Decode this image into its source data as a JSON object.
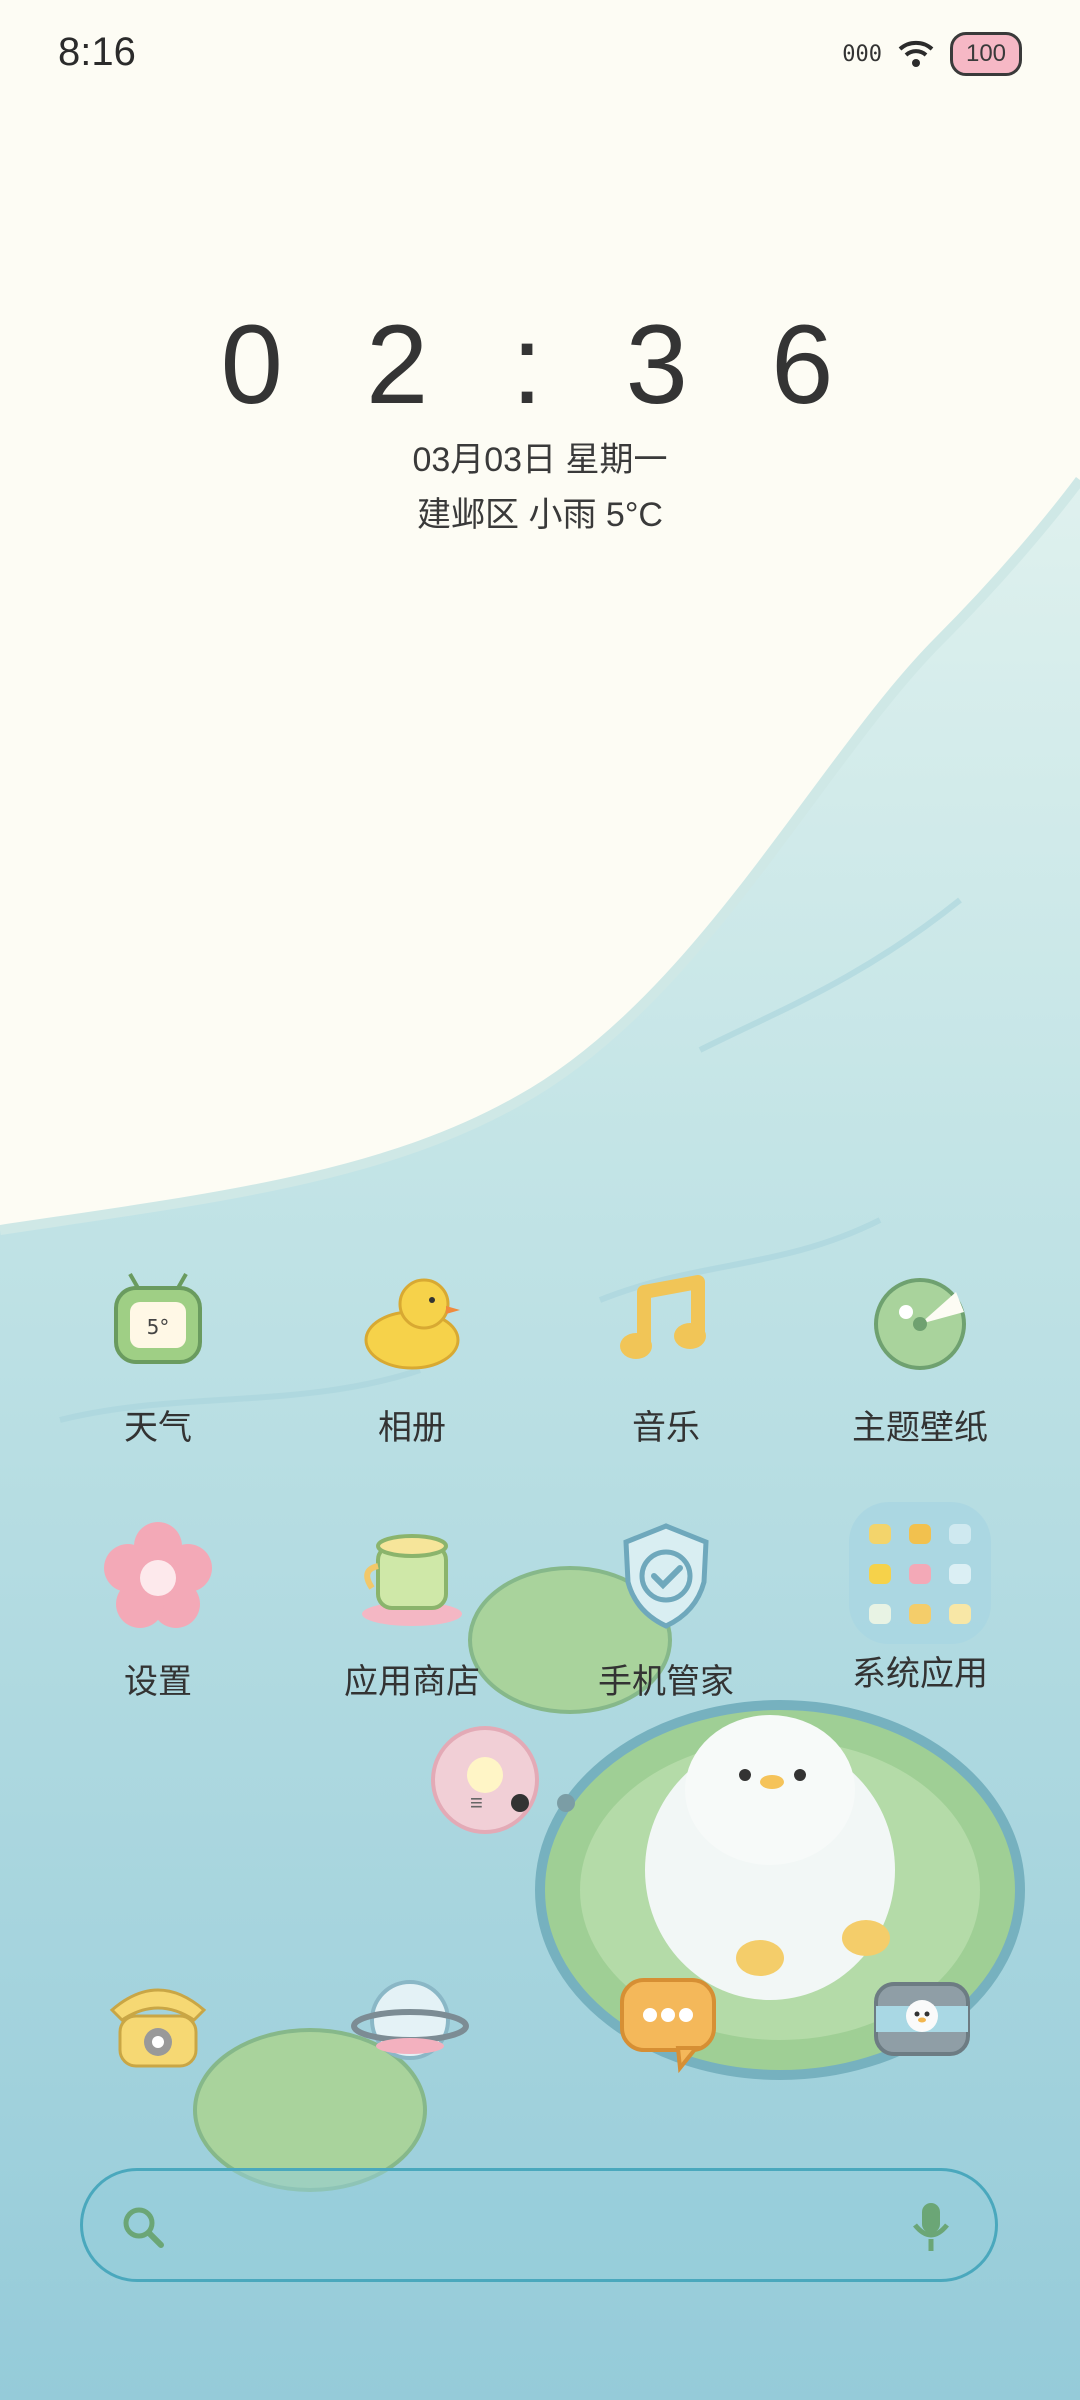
{
  "status_bar": {
    "time": "8:16",
    "signal_text": "000",
    "battery_level": "100"
  },
  "lockclock": {
    "time": "0 2 : 3 6",
    "date": "03月03日 星期一",
    "weather": "建邺区 小雨 5°C"
  },
  "apps_row1": [
    {
      "label": "天气",
      "icon": "weather-tv-icon"
    },
    {
      "label": "相册",
      "icon": "rubber-duck-icon"
    },
    {
      "label": "音乐",
      "icon": "music-note-icon"
    },
    {
      "label": "主题壁纸",
      "icon": "lily-pad-icon"
    }
  ],
  "apps_row2": [
    {
      "label": "设置",
      "icon": "flower-icon"
    },
    {
      "label": "应用商店",
      "icon": "teacup-icon"
    },
    {
      "label": "手机管家",
      "icon": "shield-check-icon"
    },
    {
      "label": "系统应用",
      "icon": "folder-grid-icon"
    }
  ],
  "dock": [
    {
      "icon": "phone-icon"
    },
    {
      "icon": "planet-icon"
    },
    {
      "icon": "message-bubble-icon"
    },
    {
      "icon": "camera-icon"
    }
  ],
  "colors": {
    "water_light": "#cfe9ea",
    "water_deep": "#8fc9d8",
    "lily_green": "#a9d39c",
    "search_border": "#4aa8bd",
    "icon_green": "#7fb07a"
  }
}
